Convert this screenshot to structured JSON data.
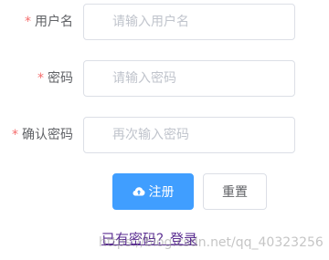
{
  "form": {
    "username": {
      "label": "用户名",
      "required_mark": "*",
      "placeholder": "请输入用户名",
      "value": ""
    },
    "password": {
      "label": "密码",
      "required_mark": "*",
      "placeholder": "请输入密码",
      "value": ""
    },
    "confirm_password": {
      "label": "确认密码",
      "required_mark": "*",
      "placeholder": "再次输入密码",
      "value": ""
    }
  },
  "actions": {
    "register_label": "注册",
    "register_icon": "upload-cloud-icon",
    "reset_label": "重置"
  },
  "login_link": {
    "text": "已有密码？登录"
  },
  "watermark": {
    "text": "https://blog.csdn.net/qq_40323256"
  },
  "colors": {
    "primary": "#409eff",
    "required": "#f56c6c",
    "link": "#5a2d91",
    "border": "#dcdfe6"
  }
}
